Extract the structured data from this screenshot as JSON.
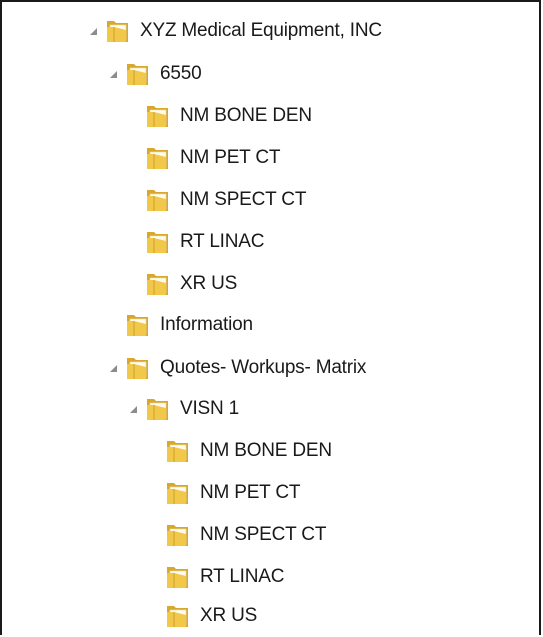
{
  "tree": {
    "root": {
      "label": "XYZ Medical Equipment, INC",
      "expanded": true,
      "icon": "folder-icon"
    },
    "n6550": {
      "label": "6550",
      "expanded": true,
      "icon": "folder-icon"
    },
    "n6550_items": [
      {
        "label": "NM BONE DEN",
        "icon": "folder-icon"
      },
      {
        "label": "NM PET CT",
        "icon": "folder-icon"
      },
      {
        "label": "NM SPECT CT",
        "icon": "folder-icon"
      },
      {
        "label": "RT LINAC",
        "icon": "folder-icon"
      },
      {
        "label": "XR US",
        "icon": "folder-icon"
      }
    ],
    "information": {
      "label": "Information",
      "icon": "folder-icon"
    },
    "quotes": {
      "label": "Quotes- Workups- Matrix",
      "expanded": true,
      "icon": "folder-icon"
    },
    "visn1": {
      "label": "VISN 1",
      "expanded": true,
      "icon": "folder-icon"
    },
    "visn1_items": [
      {
        "label": "NM BONE DEN",
        "icon": "folder-icon"
      },
      {
        "label": "NM PET CT",
        "icon": "folder-icon"
      },
      {
        "label": "NM SPECT CT",
        "icon": "folder-icon"
      },
      {
        "label": "RT LINAC",
        "icon": "folder-icon"
      },
      {
        "label": "XR US",
        "icon": "folder-icon"
      }
    ]
  },
  "colors": {
    "folder_front": "#f2c84b",
    "folder_back": "#d9a82b",
    "folder_paper": "#fdfbf0",
    "expander": "#8c8c8c"
  }
}
